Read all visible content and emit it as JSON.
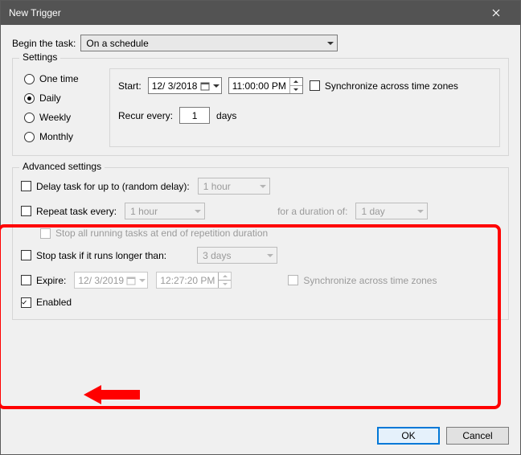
{
  "window": {
    "title": "New Trigger"
  },
  "begin": {
    "label": "Begin the task:",
    "value": "On a schedule"
  },
  "settings": {
    "legend": "Settings",
    "radios": {
      "one_time": "One time",
      "daily": "Daily",
      "weekly": "Weekly",
      "monthly": "Monthly",
      "selected": "daily"
    },
    "start_label": "Start:",
    "start_date": "12/  3/2018",
    "start_time": "11:00:00 PM",
    "sync_tz": "Synchronize across time zones",
    "recur_label": "Recur every:",
    "recur_value": "1",
    "recur_unit": "days"
  },
  "advanced": {
    "legend": "Advanced settings",
    "delay": {
      "label": "Delay task for up to (random delay):",
      "value": "1 hour"
    },
    "repeat": {
      "label": "Repeat task every:",
      "value": "1 hour",
      "duration_label": "for a duration of:",
      "duration_value": "1 day"
    },
    "stop_repeat": "Stop all running tasks at end of repetition duration",
    "stop_long": {
      "label": "Stop task if it runs longer than:",
      "value": "3 days"
    },
    "expire": {
      "label": "Expire:",
      "date": "12/  3/2019",
      "time": "12:27:20 PM",
      "sync": "Synchronize across time zones"
    },
    "enabled": "Enabled"
  },
  "buttons": {
    "ok": "OK",
    "cancel": "Cancel"
  }
}
